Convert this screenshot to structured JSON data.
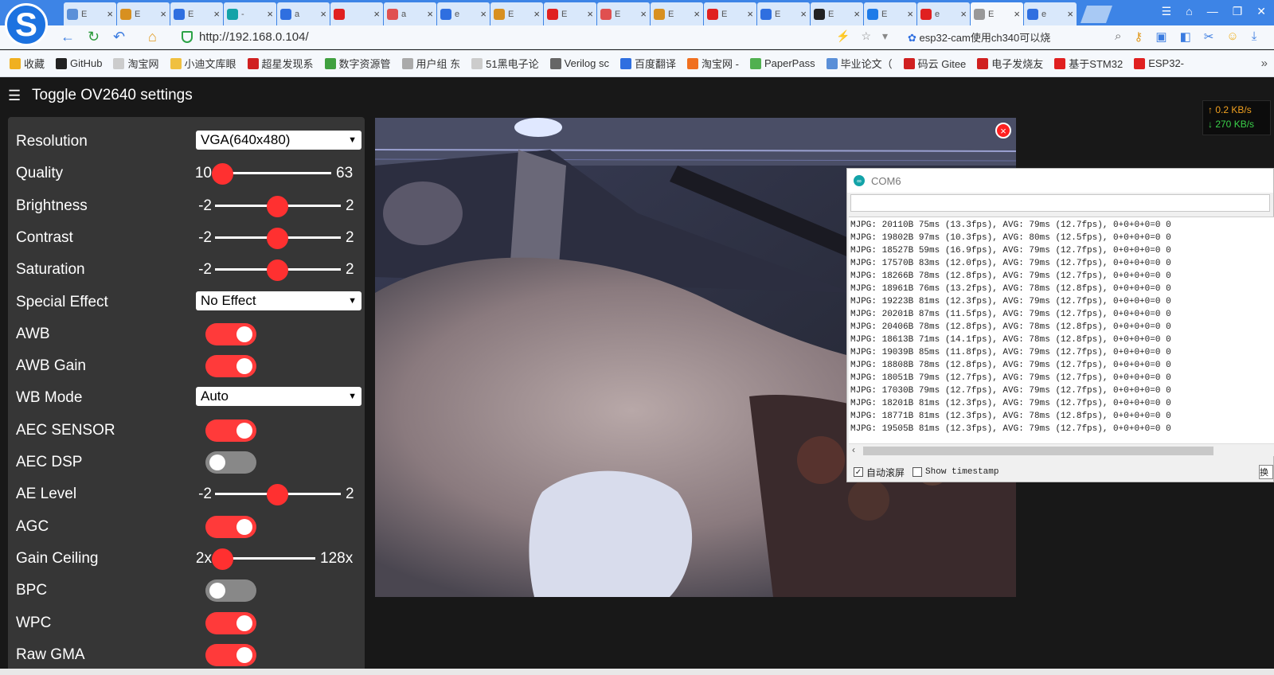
{
  "browser": {
    "logo": "S",
    "tabs": [
      {
        "label": "E",
        "icon": "globe-icon",
        "color": "#5a8fd8"
      },
      {
        "label": "E",
        "icon": "doc-icon",
        "color": "#d89020"
      },
      {
        "label": "E",
        "icon": "paw-icon",
        "color": "#2f6fe0"
      },
      {
        "label": "-",
        "icon": "infinity-icon",
        "color": "#13a3a8"
      },
      {
        "label": "a",
        "icon": "paw-icon",
        "color": "#2f6fe0"
      },
      {
        "label": "",
        "icon": "c-icon",
        "color": "#e02020"
      },
      {
        "label": "a",
        "icon": "jian-icon",
        "color": "#e05050"
      },
      {
        "label": "e",
        "icon": "paw-icon",
        "color": "#2f6fe0"
      },
      {
        "label": "E",
        "icon": "doc-icon",
        "color": "#d89020"
      },
      {
        "label": "E",
        "icon": "c-icon",
        "color": "#e02020"
      },
      {
        "label": "E",
        "icon": "jian-icon",
        "color": "#e05050"
      },
      {
        "label": "E",
        "icon": "doc-icon",
        "color": "#d89020"
      },
      {
        "label": "E",
        "icon": "c-icon",
        "color": "#e02020"
      },
      {
        "label": "E",
        "icon": "paw-icon",
        "color": "#2f6fe0"
      },
      {
        "label": "E",
        "icon": "c-icon",
        "color": "#222222"
      },
      {
        "label": "E",
        "icon": "zhi-icon",
        "color": "#1e7be8"
      },
      {
        "label": "e",
        "icon": "c-icon",
        "color": "#e02020"
      },
      {
        "label": "E",
        "icon": "doc-icon",
        "color": "#999999",
        "active": true
      },
      {
        "label": "e",
        "icon": "paw-icon",
        "color": "#2f6fe0"
      }
    ],
    "url": "http://192.168.0.104/",
    "search_text": "esp32-cam使用ch340可以烧",
    "bookmarks": [
      {
        "label": "收藏",
        "color": "#f0b020"
      },
      {
        "label": "GitHub",
        "color": "#222222"
      },
      {
        "label": "淘宝网",
        "color": "#cccccc"
      },
      {
        "label": "小迪文库眼",
        "color": "#f0c040"
      },
      {
        "label": "超星发现系",
        "color": "#d02020"
      },
      {
        "label": "数字资源管",
        "color": "#40a040"
      },
      {
        "label": "用户组 东",
        "color": "#aaaaaa"
      },
      {
        "label": "51黑电子论",
        "color": "#cccccc"
      },
      {
        "label": "Verilog sc",
        "color": "#666666"
      },
      {
        "label": "百度翻译",
        "color": "#2f6fe0"
      },
      {
        "label": "淘宝网 -",
        "color": "#f07020"
      },
      {
        "label": "PaperPass",
        "color": "#50b050"
      },
      {
        "label": "毕业论文（",
        "color": "#5a8fd8"
      },
      {
        "label": "码云 Gitee",
        "color": "#d02020"
      },
      {
        "label": "电子发烧友",
        "color": "#d02020"
      },
      {
        "label": "基于STM32",
        "color": "#e02020"
      },
      {
        "label": "ESP32-",
        "color": "#e02020"
      }
    ]
  },
  "app": {
    "title": "Toggle OV2640 settings",
    "netspeed": {
      "up": "↑ 0.2 KB/s",
      "down": "↓ 270 KB/s"
    }
  },
  "settings": [
    {
      "label": "Resolution",
      "type": "select",
      "value": "VGA(640x480)"
    },
    {
      "label": "Quality",
      "type": "slider",
      "min": "10",
      "max": "63",
      "value": 10,
      "lo": 10,
      "hi": 63
    },
    {
      "label": "Brightness",
      "type": "slider",
      "min": "-2",
      "max": "2",
      "value": 0,
      "lo": -2,
      "hi": 2
    },
    {
      "label": "Contrast",
      "type": "slider",
      "min": "-2",
      "max": "2",
      "value": 0,
      "lo": -2,
      "hi": 2
    },
    {
      "label": "Saturation",
      "type": "slider",
      "min": "-2",
      "max": "2",
      "value": 0,
      "lo": -2,
      "hi": 2
    },
    {
      "label": "Special Effect",
      "type": "select",
      "value": "No Effect"
    },
    {
      "label": "AWB",
      "type": "toggle",
      "on": true
    },
    {
      "label": "AWB Gain",
      "type": "toggle",
      "on": true
    },
    {
      "label": "WB Mode",
      "type": "select",
      "value": "Auto"
    },
    {
      "label": "AEC SENSOR",
      "type": "toggle",
      "on": true
    },
    {
      "label": "AEC DSP",
      "type": "toggle",
      "on": false
    },
    {
      "label": "AE Level",
      "type": "slider",
      "min": "-2",
      "max": "2",
      "value": 0,
      "lo": -2,
      "hi": 2
    },
    {
      "label": "AGC",
      "type": "toggle",
      "on": true
    },
    {
      "label": "Gain Ceiling",
      "type": "slider",
      "min": "2x",
      "max": "128x",
      "value": 0,
      "lo": 0,
      "hi": 6
    },
    {
      "label": "BPC",
      "type": "toggle",
      "on": false
    },
    {
      "label": "WPC",
      "type": "toggle",
      "on": true
    },
    {
      "label": "Raw GMA",
      "type": "toggle",
      "on": true
    }
  ],
  "stream": {
    "close_label": "×"
  },
  "serial": {
    "title": "COM6",
    "log": [
      "MJPG: 20110B 75ms (13.3fps), AVG: 79ms (12.7fps), 0+0+0+0=0 0",
      "MJPG: 19802B 97ms (10.3fps), AVG: 80ms (12.5fps), 0+0+0+0=0 0",
      "MJPG: 18527B 59ms (16.9fps), AVG: 79ms (12.7fps), 0+0+0+0=0 0",
      "MJPG: 17570B 83ms (12.0fps), AVG: 79ms (12.7fps), 0+0+0+0=0 0",
      "MJPG: 18266B 78ms (12.8fps), AVG: 79ms (12.7fps), 0+0+0+0=0 0",
      "MJPG: 18961B 76ms (13.2fps), AVG: 78ms (12.8fps), 0+0+0+0=0 0",
      "MJPG: 19223B 81ms (12.3fps), AVG: 79ms (12.7fps), 0+0+0+0=0 0",
      "MJPG: 20201B 87ms (11.5fps), AVG: 79ms (12.7fps), 0+0+0+0=0 0",
      "MJPG: 20406B 78ms (12.8fps), AVG: 78ms (12.8fps), 0+0+0+0=0 0",
      "MJPG: 18613B 71ms (14.1fps), AVG: 78ms (12.8fps), 0+0+0+0=0 0",
      "MJPG: 19039B 85ms (11.8fps), AVG: 79ms (12.7fps), 0+0+0+0=0 0",
      "MJPG: 18808B 78ms (12.8fps), AVG: 79ms (12.7fps), 0+0+0+0=0 0",
      "MJPG: 18051B 79ms (12.7fps), AVG: 79ms (12.7fps), 0+0+0+0=0 0",
      "MJPG: 17030B 79ms (12.7fps), AVG: 79ms (12.7fps), 0+0+0+0=0 0",
      "MJPG: 18201B 81ms (12.3fps), AVG: 79ms (12.7fps), 0+0+0+0=0 0",
      "MJPG: 18771B 81ms (12.3fps), AVG: 78ms (12.8fps), 0+0+0+0=0 0",
      "MJPG: 19505B 81ms (12.3fps), AVG: 79ms (12.7fps), 0+0+0+0=0 0"
    ],
    "autoscroll_label": "自动滚屏",
    "autoscroll_checked": true,
    "timestamp_label": "Show timestamp",
    "timestamp_checked": false,
    "line_ending_btn": "换"
  }
}
